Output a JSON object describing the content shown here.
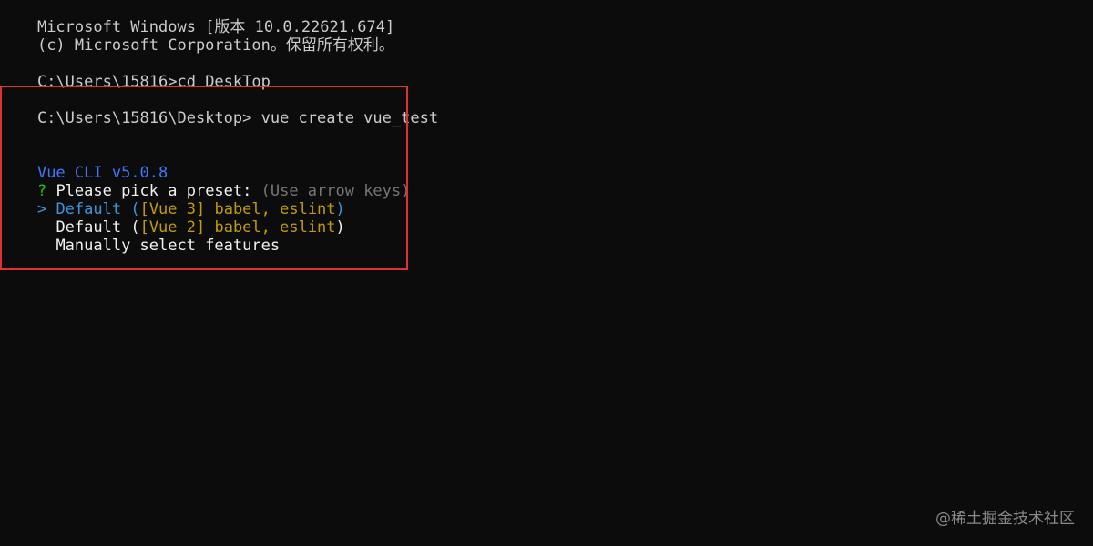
{
  "terminal": {
    "header_line_1": "Microsoft Windows [版本 10.0.22621.674]",
    "header_line_2": "(c) Microsoft Corporation。保留所有权利。",
    "prompt_1": "C:\\Users\\15816>",
    "command_1": "cd DeskTop",
    "prompt_2": "C:\\Users\\15816\\Desktop>",
    "command_2": " vue create vue_test",
    "cli_version": "Vue CLI v5.0.8",
    "question_mark": "?",
    "question_text": " Please pick a preset: ",
    "question_hint": "(Use arrow keys)",
    "options": [
      {
        "pointer": ">",
        "name": " Default ",
        "paren_open": "(",
        "tag": "[Vue 3]",
        "plugins": " babel, eslint",
        "paren_close": ")"
      },
      {
        "pointer": " ",
        "name": " Default ",
        "paren_open": "(",
        "tag": "[Vue 2]",
        "plugins": " babel, eslint",
        "paren_close": ")"
      },
      {
        "pointer": " ",
        "name": " Manually select features"
      }
    ]
  },
  "watermark": "@稀土掘金技术社区",
  "colors": {
    "background": "#0c0c0c",
    "text": "#cccccc",
    "selected": "#3a96dd",
    "cli_blue": "#3b78ff",
    "question_green": "#16c60c",
    "hint_gray": "#767676",
    "tag_yellow": "#c19c00",
    "highlight_red": "#e03131"
  }
}
